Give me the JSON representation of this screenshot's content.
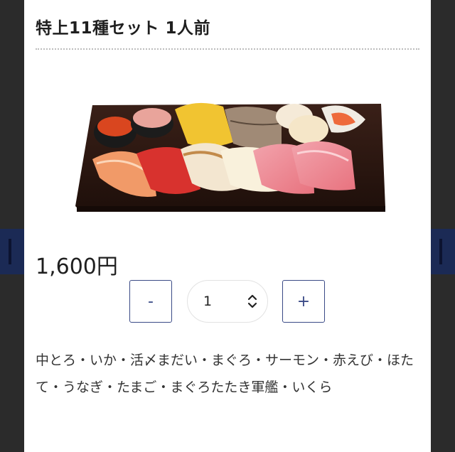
{
  "product": {
    "title": "特上11種セット 1人前",
    "price": "1,600円",
    "description": "中とろ・いか・活〆まだい・まぐろ・サーモン・赤えび・ほたて・うなぎ・たまご・まぐろたたき軍艦・いくら"
  },
  "quantity": {
    "minus_label": "-",
    "plus_label": "+",
    "selected": "1"
  },
  "icons": {
    "dropdown": "chevron-up-down-icon"
  },
  "colors": {
    "accent": "#3a4a86",
    "overlay": "#2b2b2b",
    "backdrop_band": "#1b2a55"
  }
}
